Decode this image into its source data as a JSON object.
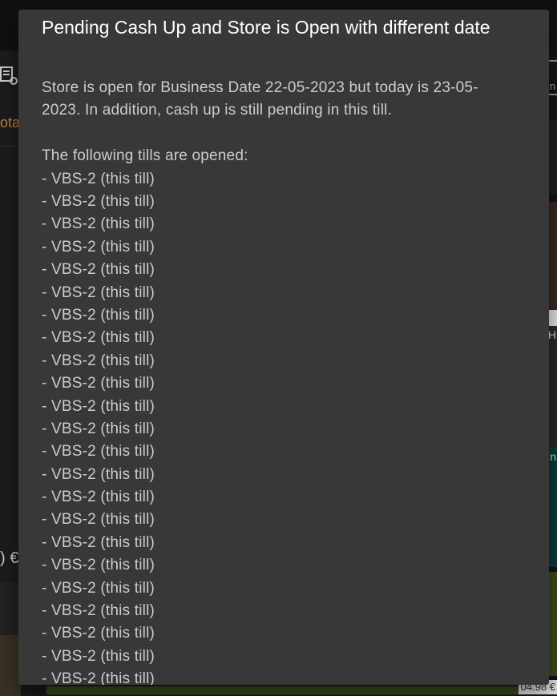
{
  "background": {
    "left_total_label": "ota",
    "left_amount": ") €",
    "right_label_1": "H",
    "right_label_2": "In",
    "right_corner_text": "n",
    "bottom_price": "04.98 €"
  },
  "dialog": {
    "title": "Pending Cash Up and Store is Open with different date",
    "message_line_1": "Store is open for Business Date 22-05-2023 but today is 23-05-",
    "message_line_2": "2023. In addition, cash up is still pending in this till.",
    "tills_heading": "The following tills are opened:",
    "tills": [
      "- VBS-2 (this till)",
      "- VBS-2 (this till)",
      "- VBS-2 (this till)",
      "- VBS-2 (this till)",
      "- VBS-2 (this till)",
      "- VBS-2 (this till)",
      "- VBS-2 (this till)",
      "- VBS-2 (this till)",
      "- VBS-2 (this till)",
      "- VBS-2 (this till)",
      "- VBS-2 (this till)",
      "- VBS-2 (this till)",
      "- VBS-2 (this till)",
      "- VBS-2 (this till)",
      "- VBS-2 (this till)",
      "- VBS-2 (this till)",
      "- VBS-2 (this till)",
      "- VBS-2 (this till)",
      "- VBS-2 (this till)",
      "- VBS-2 (this till)",
      "- VBS-2 (this till)",
      "- VBS-2 (this till)",
      "- VBS-2 (this till)"
    ]
  },
  "colors": {
    "dialog_background": "#383838",
    "dialog_title": "#ffffff",
    "dialog_text": "#cdcdcd",
    "accent_orange": "#c8863e"
  },
  "icons": [
    "receipt-settings-icon",
    "expand-icon"
  ]
}
